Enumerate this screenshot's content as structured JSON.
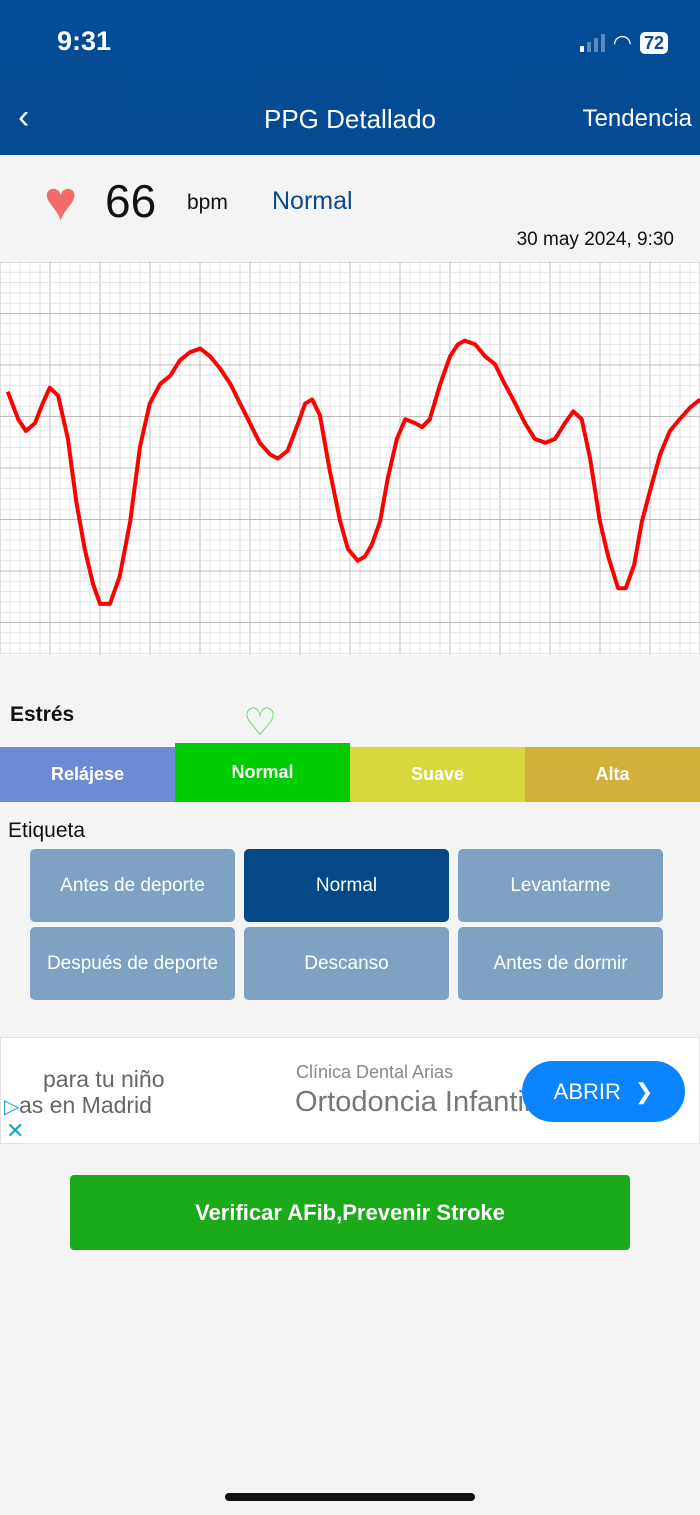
{
  "status_bar": {
    "time": "9:31",
    "battery": "72"
  },
  "nav": {
    "title": "PPG Detallado",
    "right_action": "Tendencia"
  },
  "reading": {
    "icon": "heart-icon",
    "bpm": "66",
    "unit": "bpm",
    "status": "Normal",
    "datetime": "30 may 2024, 9:30"
  },
  "chart_data": {
    "type": "line",
    "title": "",
    "xlabel": "",
    "ylabel": "",
    "grid": true,
    "xlim": [
      0,
      100
    ],
    "ylim": [
      0,
      100
    ],
    "color": "#ff0000",
    "x": [
      1.1,
      2.6,
      3.7,
      5,
      6.1,
      7.1,
      8.3,
      9.7,
      10.9,
      12.1,
      13.3,
      14.3,
      15.7,
      17.1,
      18.6,
      20,
      21.4,
      22.9,
      24.3,
      25.7,
      27.1,
      28.6,
      30,
      31.4,
      32.9,
      34.3,
      35.7,
      37.1,
      38.6,
      39.7,
      41.1,
      42.6,
      43.6,
      44.6,
      45.7,
      47.1,
      48.6,
      49.7,
      51.1,
      52.1,
      53.1,
      54.3,
      55.4,
      56.7,
      57.9,
      59.3,
      60.3,
      61.4,
      62.9,
      64.3,
      65.4,
      66.4,
      67.9,
      69.3,
      70.7,
      72.1,
      73.6,
      75,
      76.4,
      77.9,
      79.3,
      80.7,
      81.9,
      83.1,
      84.3,
      85.7,
      86.9,
      88.3,
      89.4,
      90.6,
      91.7,
      92.9,
      94.3,
      95.7,
      97.1,
      98.6,
      100
    ],
    "y": [
      67,
      60,
      57,
      59,
      64,
      68,
      66,
      55,
      39,
      27,
      18,
      13,
      13,
      20,
      34,
      53,
      64,
      69,
      71,
      75,
      77,
      78,
      76,
      73,
      69,
      64,
      59,
      54,
      51,
      50,
      52,
      59,
      64,
      65,
      61,
      47,
      34,
      27,
      24,
      25,
      28,
      34,
      45,
      55,
      60,
      59,
      58,
      60,
      69,
      76,
      79,
      80,
      79,
      76,
      74,
      69,
      64,
      59,
      55,
      54,
      55,
      59,
      62,
      60,
      50,
      34,
      25,
      17,
      17,
      23,
      34,
      42,
      51,
      57,
      60,
      63,
      65
    ]
  },
  "stress": {
    "label": "Estrés",
    "levels": [
      {
        "label": "Relájese",
        "color": "#6b8bd6"
      },
      {
        "label": "Normal",
        "color": "#00cc00"
      },
      {
        "label": "Suave",
        "color": "#d7d83c"
      },
      {
        "label": "Alta",
        "color": "#d4af3c"
      }
    ],
    "selected": "Normal"
  },
  "tags": {
    "label": "Etiqueta",
    "items": [
      "Antes de deporte",
      "Normal",
      "Levantarme",
      "Después de deporte",
      "Descanso",
      "Antes de dormir"
    ],
    "selected": "Normal"
  },
  "ad": {
    "left_line1": "para tu niño",
    "left_line2": "as en Madrid",
    "advertiser": "Clínica Dental Arias",
    "headline": "Ortodoncia Infantil",
    "cta": "ABRIR"
  },
  "afib_button": "Verificar AFib,Prevenir Stroke"
}
